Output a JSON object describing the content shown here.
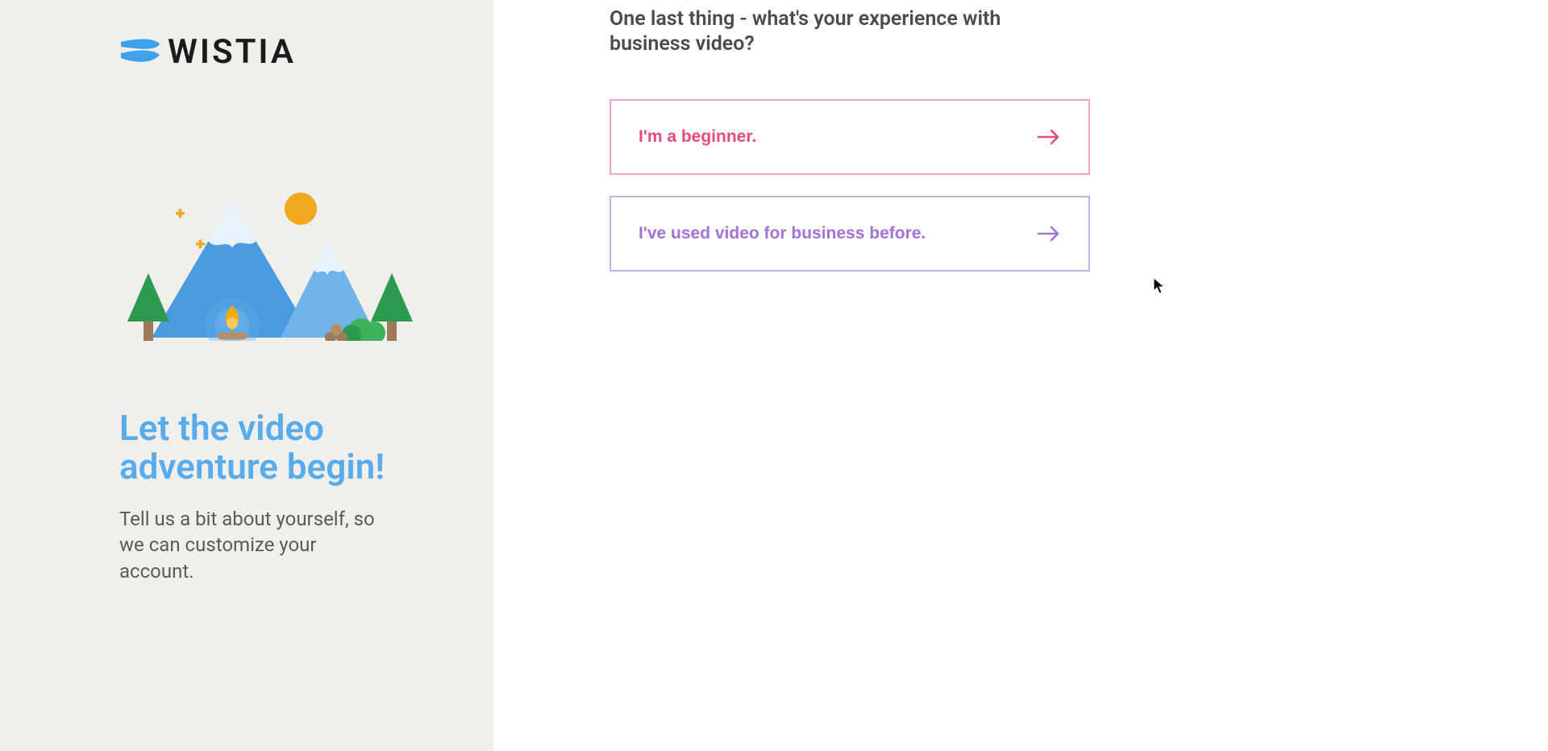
{
  "brand": {
    "name": "WISTIA"
  },
  "sidebar": {
    "headline": "Let the video adventure begin!",
    "subline": "Tell us a bit about yourself, so we can customize your account."
  },
  "main": {
    "question": "One last thing - what's your experience with business video?",
    "options": [
      {
        "label": "I'm a beginner."
      },
      {
        "label": "I've used video for business before."
      }
    ]
  },
  "colors": {
    "pink": "#e84a7a",
    "purple": "#a273d8",
    "blue": "#59acec"
  }
}
